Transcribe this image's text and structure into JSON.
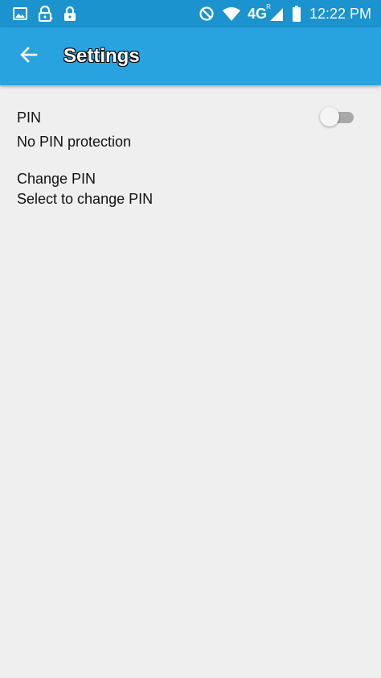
{
  "status_bar": {
    "time": "12:22 PM",
    "network_label": "4G",
    "roaming_label": "R",
    "icons": [
      "image-icon",
      "pin-lock-notification-icon",
      "lock-icon",
      "do-not-disturb-icon",
      "wifi-icon",
      "signal-icon",
      "battery-icon"
    ]
  },
  "app_bar": {
    "title": "Settings",
    "back_icon": "arrow-back-icon"
  },
  "preferences": [
    {
      "title": "PIN",
      "summary": "No PIN protection",
      "toggle_state": "off"
    },
    {
      "title": "Change PIN",
      "summary": "Select to change PIN"
    }
  ],
  "colors": {
    "status_bar": "#1a93cf",
    "app_bar": "#29a3df",
    "background": "#efefef",
    "switch_track_off": "#a8a8a8",
    "switch_thumb_off": "#f4f4f4"
  }
}
